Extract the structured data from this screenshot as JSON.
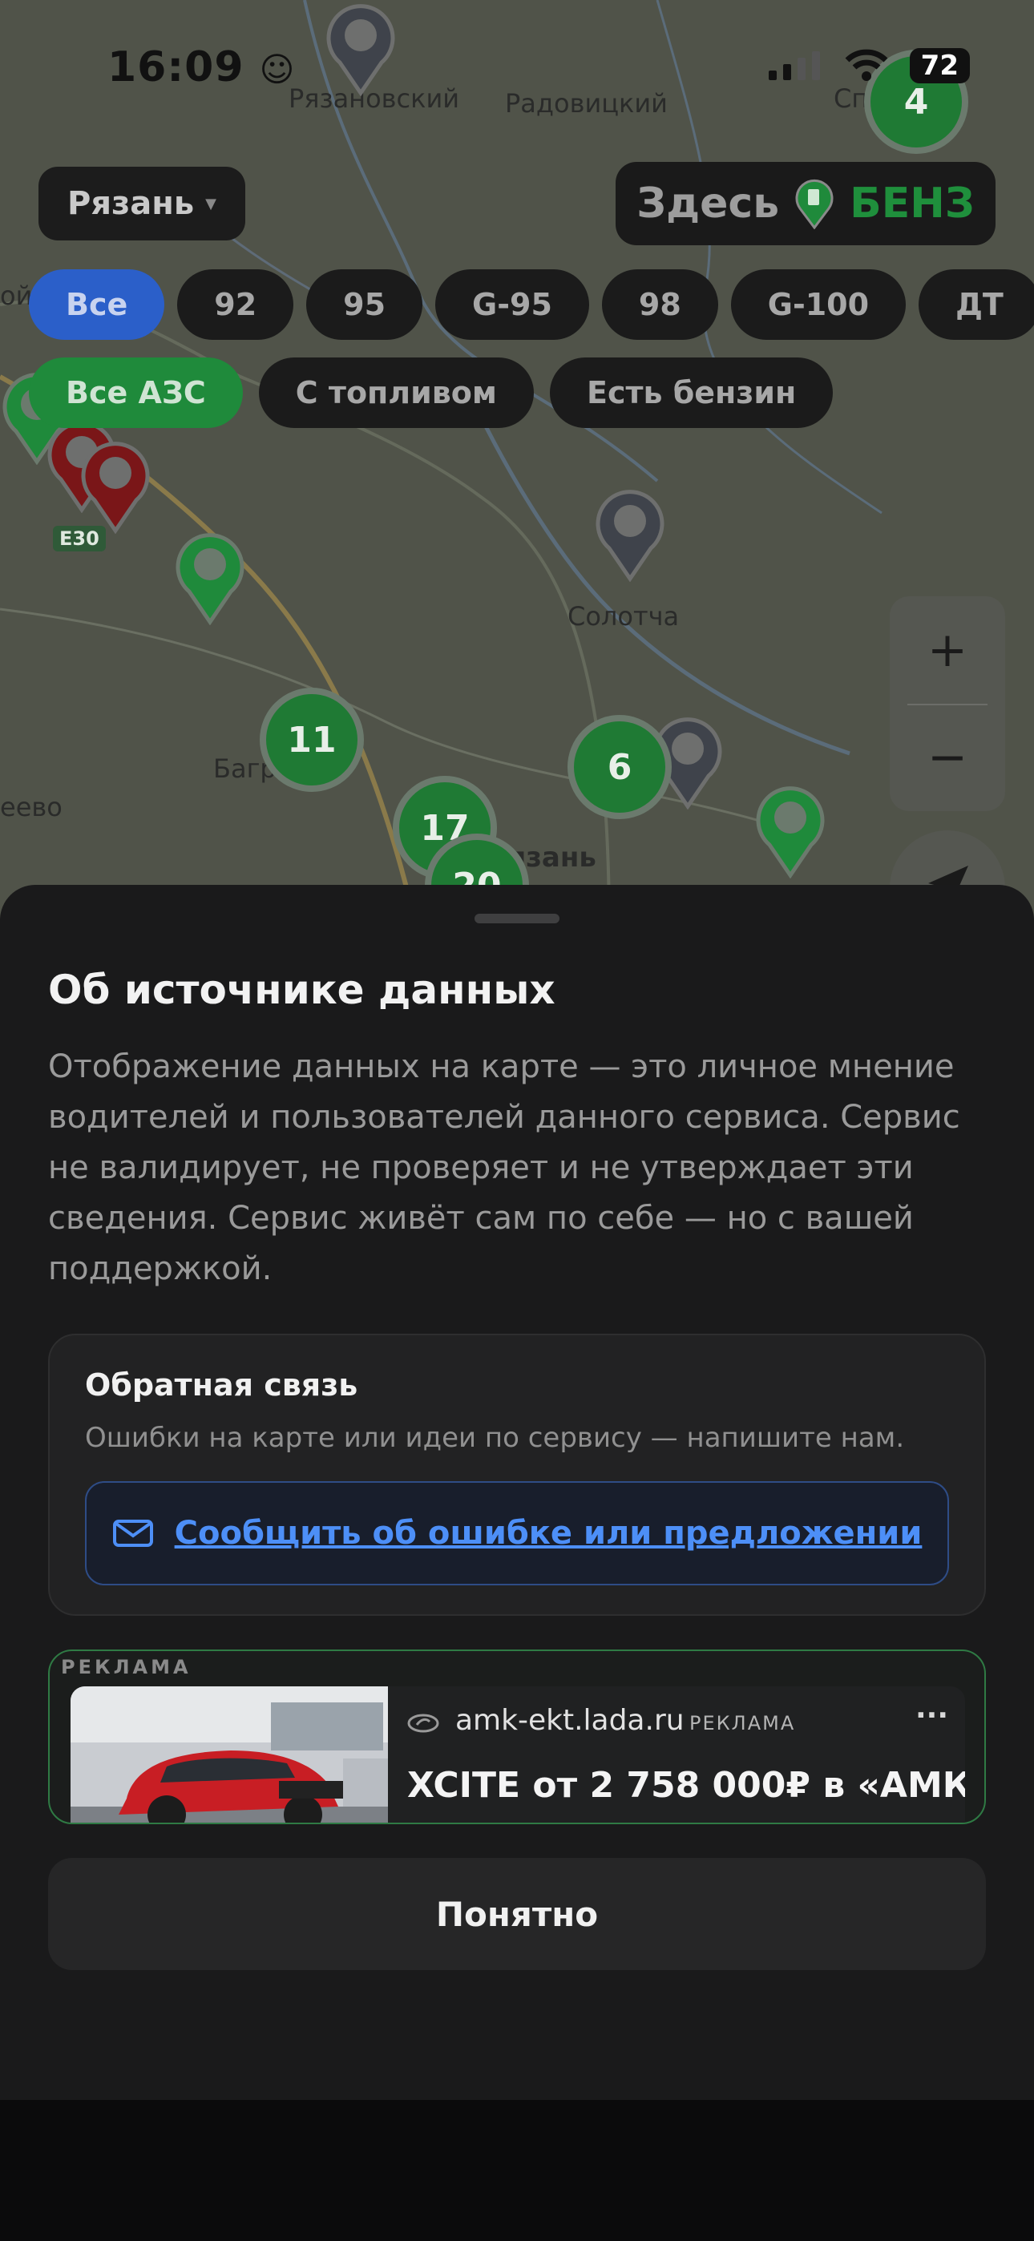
{
  "status": {
    "time": "16:09",
    "battery": "72"
  },
  "map": {
    "places": [
      "Рязановский",
      "Радовицкий",
      "Спасский",
      "Солотча",
      "Багр",
      "еево",
      "ойм",
      "рязань"
    ],
    "road": "E30",
    "clusters": [
      "4",
      "11",
      "6",
      "17",
      "20"
    ]
  },
  "controls": {
    "city": "Рязань",
    "brand_left": "Здесь",
    "brand_right": "БЕНЗ",
    "fuel_chips": [
      "Все",
      "92",
      "95",
      "G-95",
      "98",
      "G-100",
      "ДТ"
    ],
    "station_chips": [
      "Все АЗС",
      "С топливом",
      "Есть бензин"
    ],
    "zoom_in": "+",
    "zoom_out": "−"
  },
  "sheet": {
    "title": "Об источнике данных",
    "body": "Отображение данных на карте — это личное мнение водителей и пользователей данного сервиса. Сервис не валидирует, не проверяет и не утверждает эти сведения. Сервис живёт сам по себе — но с вашей поддержкой.",
    "feedback": {
      "title": "Обратная связь",
      "subtitle": "Ошибки на карте или идеи по сервису — напишите нам.",
      "button": "Сообщить об ошибке или предложении"
    },
    "ad": {
      "tag": "РЕКЛАМА",
      "domain": "amk-ekt.lada.ru",
      "label": "РЕКЛАМА",
      "more": "···",
      "headline": "XCITE от 2 758 000₽ в «АМК"
    },
    "ok_button": "Понятно"
  },
  "colors": {
    "accent_green": "#1f8a3b",
    "accent_blue": "#2b5fc9",
    "link_blue": "#4d8ff7"
  }
}
